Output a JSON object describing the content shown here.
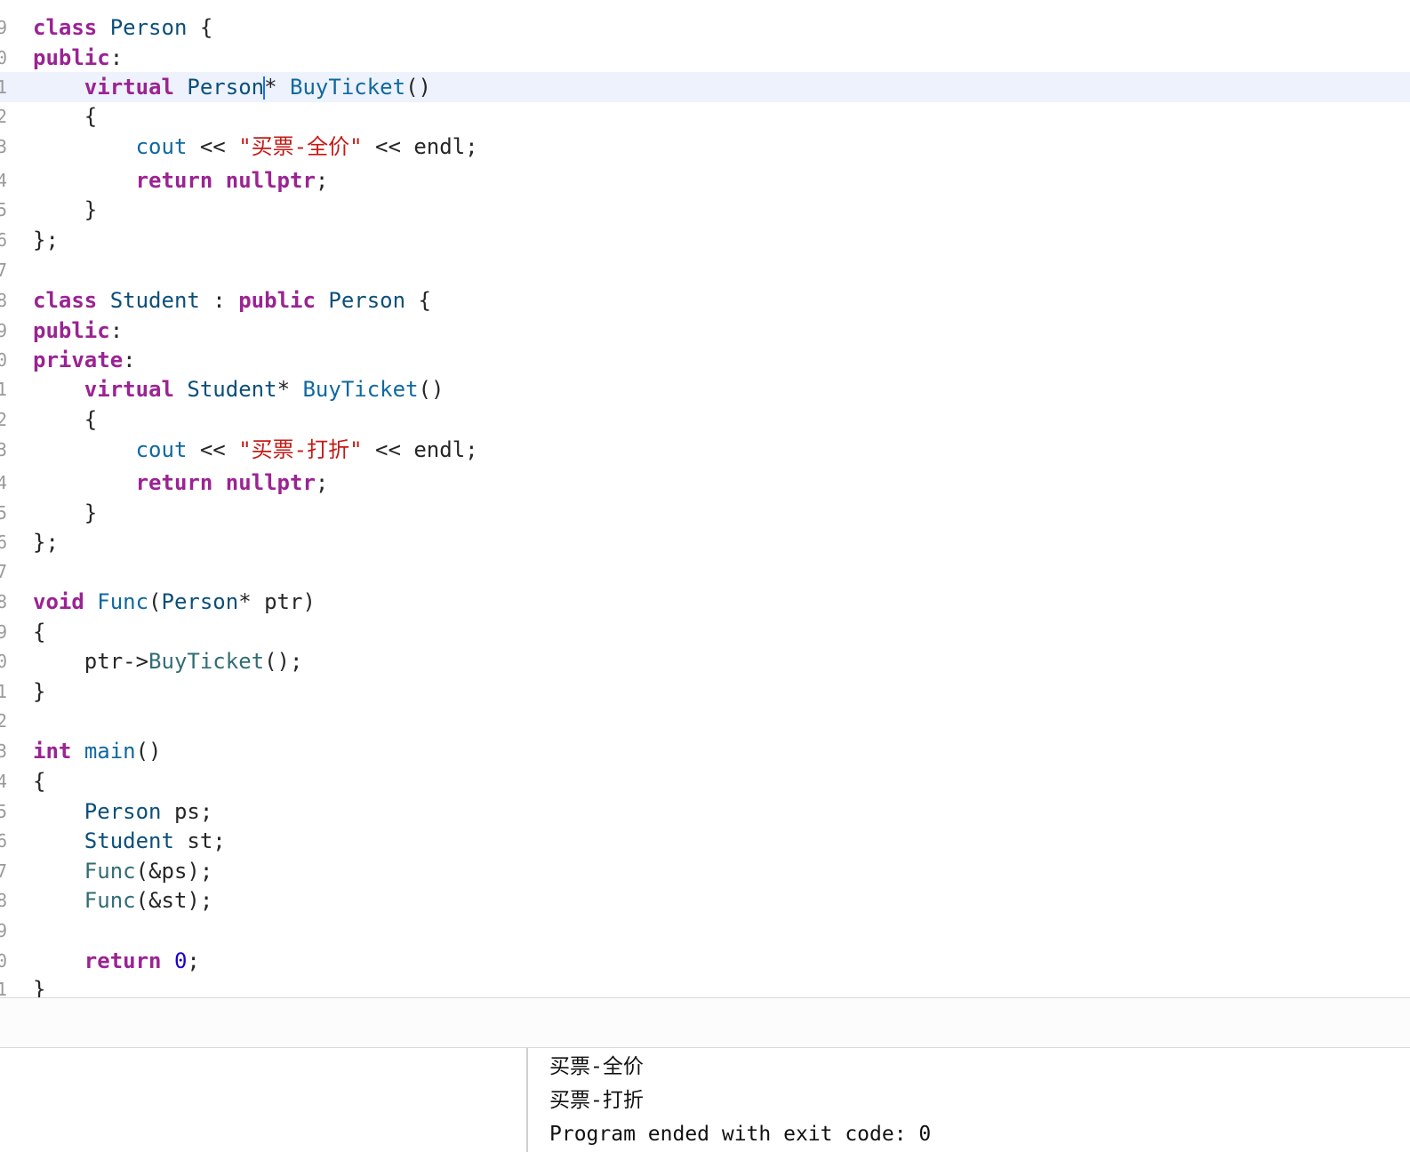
{
  "editor": {
    "lines": [
      {
        "number": "9",
        "tokens": [
          {
            "t": "class",
            "c": "kw"
          },
          {
            "t": " "
          },
          {
            "t": "Person",
            "c": "type"
          },
          {
            "t": " {"
          }
        ]
      },
      {
        "number": "0",
        "tokens": [
          {
            "t": "public",
            "c": "kw"
          },
          {
            "t": ":"
          }
        ]
      },
      {
        "number": "1",
        "current": true,
        "tokens": [
          {
            "t": "    "
          },
          {
            "t": "virtual",
            "c": "kw"
          },
          {
            "t": " "
          },
          {
            "t": "Person",
            "c": "type"
          },
          {
            "cursor": true
          },
          {
            "t": "* "
          },
          {
            "t": "BuyTicket",
            "c": "decl"
          },
          {
            "t": "()"
          }
        ]
      },
      {
        "number": "2",
        "tokens": [
          {
            "t": "    {"
          }
        ]
      },
      {
        "number": "3",
        "tokens": [
          {
            "t": "        "
          },
          {
            "t": "cout",
            "c": "decl"
          },
          {
            "t": " << "
          },
          {
            "t": "\"买票-全价\"",
            "c": "str"
          },
          {
            "t": " << endl;"
          }
        ]
      },
      {
        "number": "4",
        "tokens": [
          {
            "t": "        "
          },
          {
            "t": "return",
            "c": "kw"
          },
          {
            "t": " "
          },
          {
            "t": "nullptr",
            "c": "kw"
          },
          {
            "t": ";"
          }
        ]
      },
      {
        "number": "5",
        "tokens": [
          {
            "t": "    }"
          }
        ]
      },
      {
        "number": "6",
        "tokens": [
          {
            "t": "};"
          }
        ]
      },
      {
        "number": "7",
        "tokens": []
      },
      {
        "number": "8",
        "tokens": [
          {
            "t": "class",
            "c": "kw"
          },
          {
            "t": " "
          },
          {
            "t": "Student",
            "c": "type"
          },
          {
            "t": " : "
          },
          {
            "t": "public",
            "c": "kw"
          },
          {
            "t": " "
          },
          {
            "t": "Person",
            "c": "type"
          },
          {
            "t": " {"
          }
        ]
      },
      {
        "number": "9",
        "tokens": [
          {
            "t": "public",
            "c": "kw"
          },
          {
            "t": ":"
          }
        ]
      },
      {
        "number": "0",
        "tokens": [
          {
            "t": "private",
            "c": "kw"
          },
          {
            "t": ":"
          }
        ]
      },
      {
        "number": "1",
        "tokens": [
          {
            "t": "    "
          },
          {
            "t": "virtual",
            "c": "kw"
          },
          {
            "t": " "
          },
          {
            "t": "Student",
            "c": "type"
          },
          {
            "t": "* "
          },
          {
            "t": "BuyTicket",
            "c": "decl"
          },
          {
            "t": "()"
          }
        ]
      },
      {
        "number": "2",
        "tokens": [
          {
            "t": "    {"
          }
        ]
      },
      {
        "number": "3",
        "tokens": [
          {
            "t": "        "
          },
          {
            "t": "cout",
            "c": "decl"
          },
          {
            "t": " << "
          },
          {
            "t": "\"买票-打折\"",
            "c": "str"
          },
          {
            "t": " << endl;"
          }
        ]
      },
      {
        "number": "4",
        "tokens": [
          {
            "t": "        "
          },
          {
            "t": "return",
            "c": "kw"
          },
          {
            "t": " "
          },
          {
            "t": "nullptr",
            "c": "kw"
          },
          {
            "t": ";"
          }
        ]
      },
      {
        "number": "5",
        "tokens": [
          {
            "t": "    }"
          }
        ]
      },
      {
        "number": "6",
        "tokens": [
          {
            "t": "};"
          }
        ]
      },
      {
        "number": "7",
        "tokens": []
      },
      {
        "number": "8",
        "tokens": [
          {
            "t": "void",
            "c": "kw"
          },
          {
            "t": " "
          },
          {
            "t": "Func",
            "c": "decl"
          },
          {
            "t": "("
          },
          {
            "t": "Person",
            "c": "type"
          },
          {
            "t": "* ptr)"
          }
        ]
      },
      {
        "number": "9",
        "tokens": [
          {
            "t": "{"
          }
        ]
      },
      {
        "number": "0",
        "tokens": [
          {
            "t": "    ptr->"
          },
          {
            "t": "BuyTicket",
            "c": "fn"
          },
          {
            "t": "();"
          }
        ]
      },
      {
        "number": "1",
        "tokens": [
          {
            "t": "}"
          }
        ]
      },
      {
        "number": "2",
        "tokens": []
      },
      {
        "number": "3",
        "tokens": [
          {
            "t": "int",
            "c": "kw"
          },
          {
            "t": " "
          },
          {
            "t": "main",
            "c": "decl"
          },
          {
            "t": "()"
          }
        ]
      },
      {
        "number": "4",
        "tokens": [
          {
            "t": "{"
          }
        ]
      },
      {
        "number": "5",
        "tokens": [
          {
            "t": "    "
          },
          {
            "t": "Person",
            "c": "type"
          },
          {
            "t": " ps;"
          }
        ]
      },
      {
        "number": "6",
        "tokens": [
          {
            "t": "    "
          },
          {
            "t": "Student",
            "c": "type"
          },
          {
            "t": " st;"
          }
        ]
      },
      {
        "number": "7",
        "tokens": [
          {
            "t": "    "
          },
          {
            "t": "Func",
            "c": "fn"
          },
          {
            "t": "(&ps);"
          }
        ]
      },
      {
        "number": "8",
        "tokens": [
          {
            "t": "    "
          },
          {
            "t": "Func",
            "c": "fn"
          },
          {
            "t": "(&st);"
          }
        ]
      },
      {
        "number": "9",
        "tokens": []
      },
      {
        "number": "0",
        "tokens": [
          {
            "t": "    "
          },
          {
            "t": "return",
            "c": "kw"
          },
          {
            "t": " "
          },
          {
            "t": "0",
            "c": "num"
          },
          {
            "t": ";"
          }
        ]
      },
      {
        "number": "1",
        "tokens": [
          {
            "t": "}"
          }
        ]
      }
    ]
  },
  "console": {
    "lines": [
      "买票-全价",
      "买票-打折",
      "Program ended with exit code: 0"
    ]
  },
  "colors": {
    "keyword": "#9b2393",
    "type": "#0b4f79",
    "declaration": "#0f68a0",
    "function": "#326d74",
    "string": "#c41a16",
    "number": "#1c00cf",
    "current_line": "#edf2fc"
  }
}
